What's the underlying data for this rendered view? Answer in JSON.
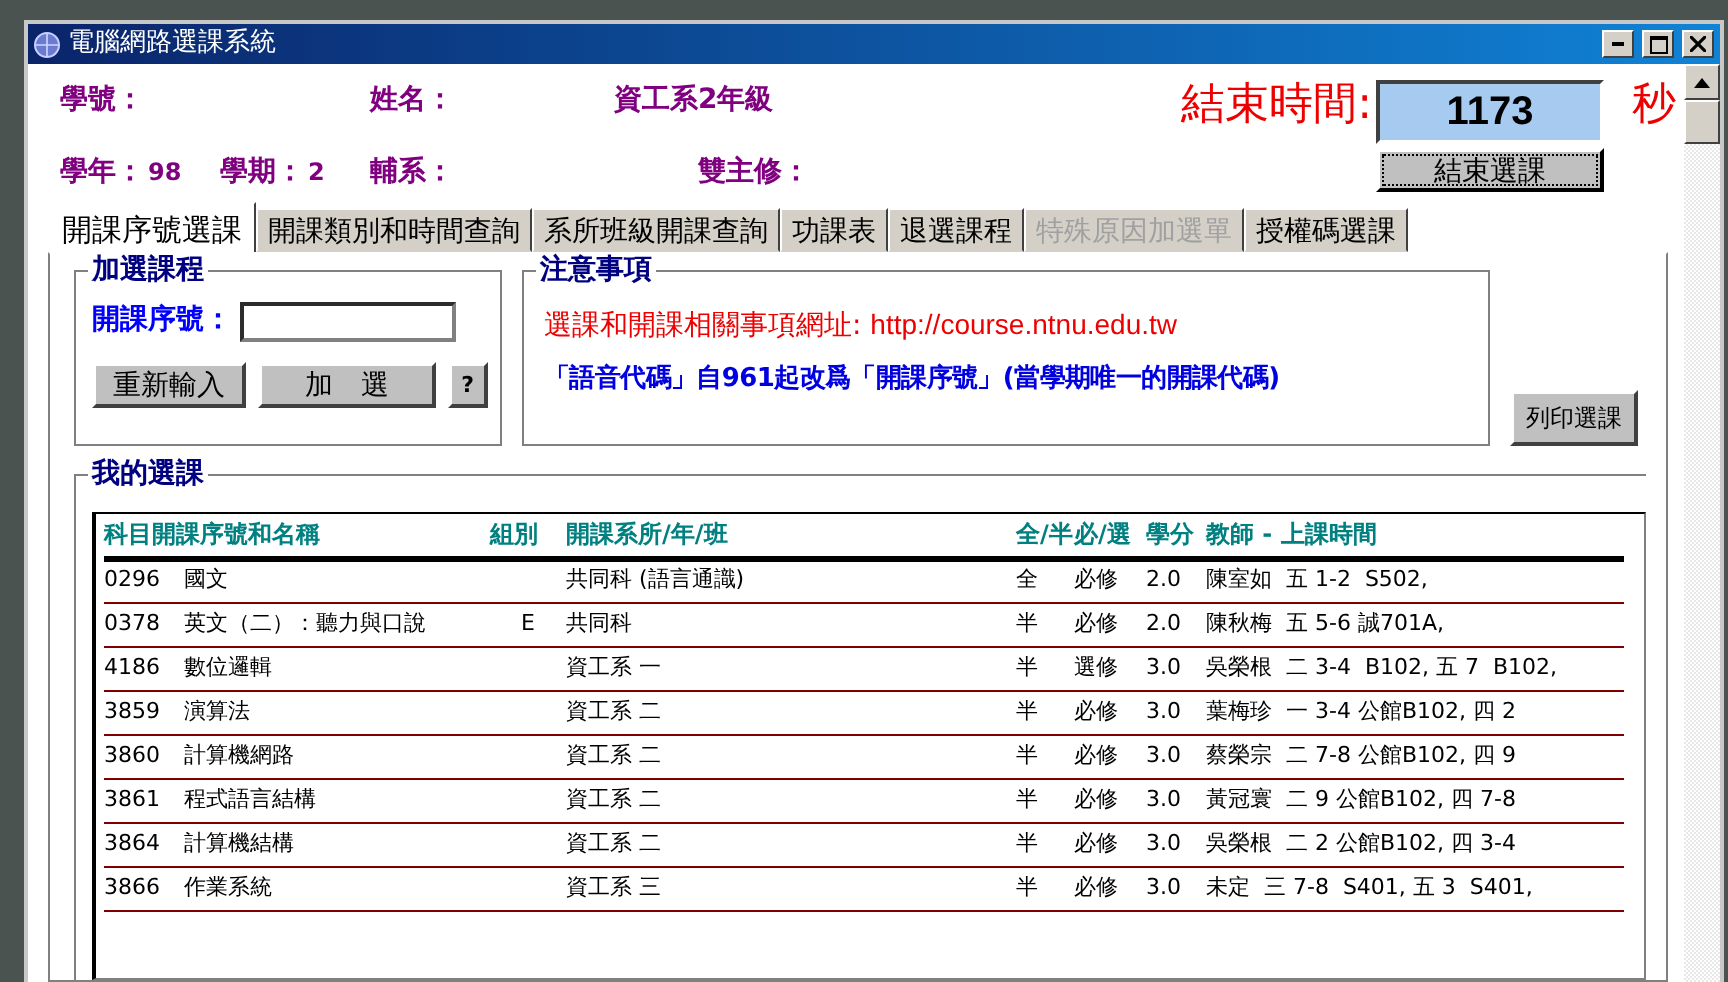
{
  "window": {
    "title": "電腦網路選課系統"
  },
  "student_fields": [
    {
      "label": "學號："
    },
    {
      "label": "姓名："
    },
    {
      "value": "資工系2年級"
    },
    {
      "label": "學年：",
      "value": "98"
    },
    {
      "label": "學期：",
      "value": "2"
    },
    {
      "label": "輔系："
    },
    {
      "label": "雙主修："
    }
  ],
  "timer": {
    "label": "結束時間:",
    "value": "1173",
    "unit": "秒",
    "end_button": "結束選課"
  },
  "tabs": [
    {
      "label": "開課序號選課",
      "selected": true,
      "disabled": false
    },
    {
      "label": "開課類別和時間查詢",
      "selected": false,
      "disabled": false
    },
    {
      "label": "系所班級開課查詢",
      "selected": false,
      "disabled": false
    },
    {
      "label": "功課表",
      "selected": false,
      "disabled": false
    },
    {
      "label": "退選課程",
      "selected": false,
      "disabled": false
    },
    {
      "label": "特殊原因加選單",
      "selected": false,
      "disabled": true
    },
    {
      "label": "授權碼選課",
      "selected": false,
      "disabled": false
    }
  ],
  "add_course": {
    "legend": "加選課程",
    "field_label": "開課序號：",
    "buttons": [
      "重新輸入",
      "加　選",
      "?"
    ]
  },
  "notice": {
    "legend": "注意事項",
    "url_label": "選課和開課相關事項網址:",
    "url": "http://course.ntnu.edu.tw",
    "message": "「語音代碼」自961起改爲「開課序號」(當學期唯一的開課代碼)"
  },
  "print_button": "列印選課",
  "my_courses": {
    "legend": "我的選課",
    "columns": [
      "科目開課序號和名稱",
      "組別",
      "開課系所/年/班",
      "全/半",
      "必/選",
      "學分",
      "教師 - 上課時間"
    ],
    "rows": [
      {
        "code": "0296",
        "name": "國文",
        "group": "",
        "dept": "共同科 (語言通識)",
        "term": "全",
        "type": "必修",
        "credit": "2.0",
        "teacher": "陳室如",
        "time": "五 1-2  S502,"
      },
      {
        "code": "0378",
        "name": "英文（二）：聽力與口說",
        "group": "E",
        "dept": "共同科",
        "term": "半",
        "type": "必修",
        "credit": "2.0",
        "teacher": "陳秋梅",
        "time": "五 5-6 誠701A,"
      },
      {
        "code": "4186",
        "name": "數位邏輯",
        "group": "",
        "dept": "資工系 一",
        "term": "半",
        "type": "選修",
        "credit": "3.0",
        "teacher": "吳榮根",
        "time": "二 3-4  B102, 五 7  B102,"
      },
      {
        "code": "3859",
        "name": "演算法",
        "group": "",
        "dept": "資工系 二",
        "term": "半",
        "type": "必修",
        "credit": "3.0",
        "teacher": "葉梅珍",
        "time": "一 3-4 公館B102, 四 2"
      },
      {
        "code": "3860",
        "name": "計算機網路",
        "group": "",
        "dept": "資工系 二",
        "term": "半",
        "type": "必修",
        "credit": "3.0",
        "teacher": "蔡榮宗",
        "time": "二 7-8 公館B102, 四 9"
      },
      {
        "code": "3861",
        "name": "程式語言結構",
        "group": "",
        "dept": "資工系 二",
        "term": "半",
        "type": "必修",
        "credit": "3.0",
        "teacher": "黃冠寰",
        "time": "二 9 公館B102, 四 7-8"
      },
      {
        "code": "3864",
        "name": "計算機結構",
        "group": "",
        "dept": "資工系 二",
        "term": "半",
        "type": "必修",
        "credit": "3.0",
        "teacher": "吳榮根",
        "time": "二 2 公館B102, 四 3-4"
      },
      {
        "code": "3866",
        "name": "作業系統",
        "group": "",
        "dept": "資工系 三",
        "term": "半",
        "type": "必修",
        "credit": "3.0",
        "teacher": "未定",
        "time": "三 7-8  S401, 五 3  S401,"
      }
    ]
  }
}
